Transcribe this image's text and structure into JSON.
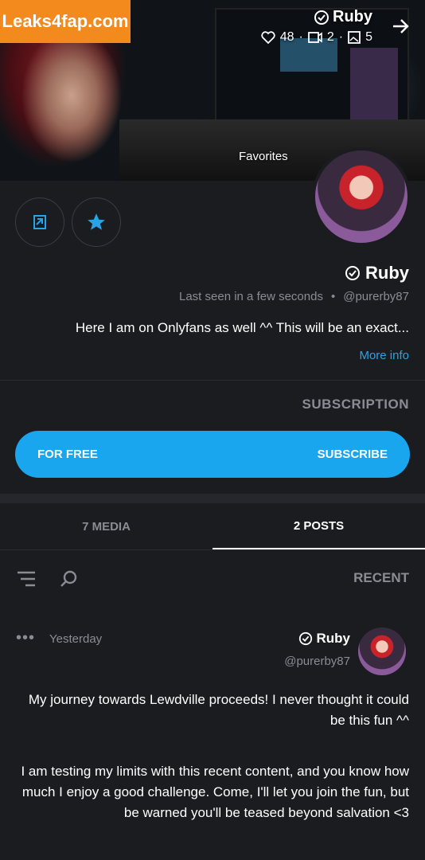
{
  "watermark": "Leaks4fap.com",
  "cover": {
    "name": "Ruby",
    "stats": {
      "images": "5",
      "videos": "2",
      "likes": "48"
    },
    "favorites_label": "Favorites"
  },
  "profile": {
    "name": "Ruby",
    "handle": "@purerby87",
    "last_seen": "Last seen in a few seconds",
    "bio": "Here I am on Onlyfans as well ^^ This will be an exact...",
    "more_info": "More info"
  },
  "subscription": {
    "title": "SUBSCRIPTION",
    "button_left": "FOR FREE",
    "button_right": "SUBSCRIBE"
  },
  "tabs": [
    {
      "label": "2 POSTS"
    },
    {
      "label": "7 MEDIA"
    }
  ],
  "feed": {
    "sort_label": "RECENT"
  },
  "post": {
    "name": "Ruby",
    "handle": "@purerby87",
    "time": "Yesterday",
    "more": "•••",
    "paragraph1": "My journey towards Lewdville proceeds! I never thought it could be this fun ^^",
    "paragraph2": "I am testing my limits with this recent content, and you know how much I enjoy a good challenge. Come, I'll let you join the fun, but be warned you'll be teased beyond salvation <3"
  },
  "colors": {
    "accent": "#1aa6ee",
    "background": "#1b1c20",
    "muted": "#8a8c94"
  },
  "icons": [
    "verified-icon",
    "arrow-icon",
    "image-icon",
    "video-icon",
    "heart-icon",
    "share-icon",
    "star-icon",
    "search-icon",
    "filter-icon",
    "more-icon"
  ]
}
